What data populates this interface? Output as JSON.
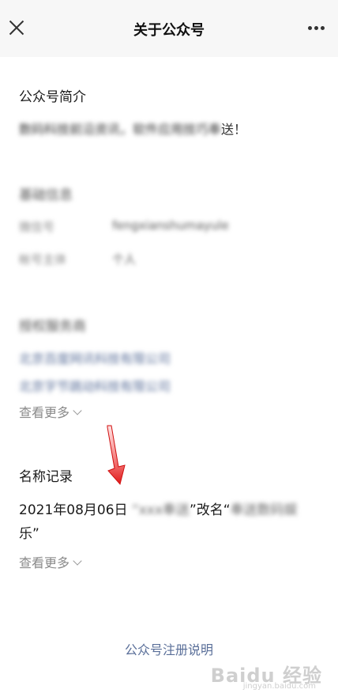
{
  "header": {
    "title": "关于公众号"
  },
  "intro": {
    "title": "公众号简介",
    "text_blurred": "数码科技前沿资讯，软件应用技巧奉",
    "text_end": "送！"
  },
  "basic_info": {
    "title": "基础信息",
    "rows": [
      {
        "label": "微信号",
        "value": "fengxianshumayule"
      },
      {
        "label": "帐号主体",
        "value": "个人"
      }
    ]
  },
  "authorized": {
    "title": "授权服务商",
    "links": [
      "北京百度网讯科技有限公司",
      "北京字节跳动科技有限公司"
    ],
    "see_more": "查看更多"
  },
  "name_record": {
    "title": "名称记录",
    "date": "2021年08月06日",
    "old_name_blurred": "“xxx奉送",
    "rename_text": "”改名“",
    "new_name_blurred": "奉送数码娱",
    "line2": "乐”",
    "see_more": "查看更多"
  },
  "footer": {
    "link": "公众号注册说明"
  },
  "watermark": {
    "brand": "Baidu 经验",
    "sub": "jingyan.baidu.com"
  }
}
